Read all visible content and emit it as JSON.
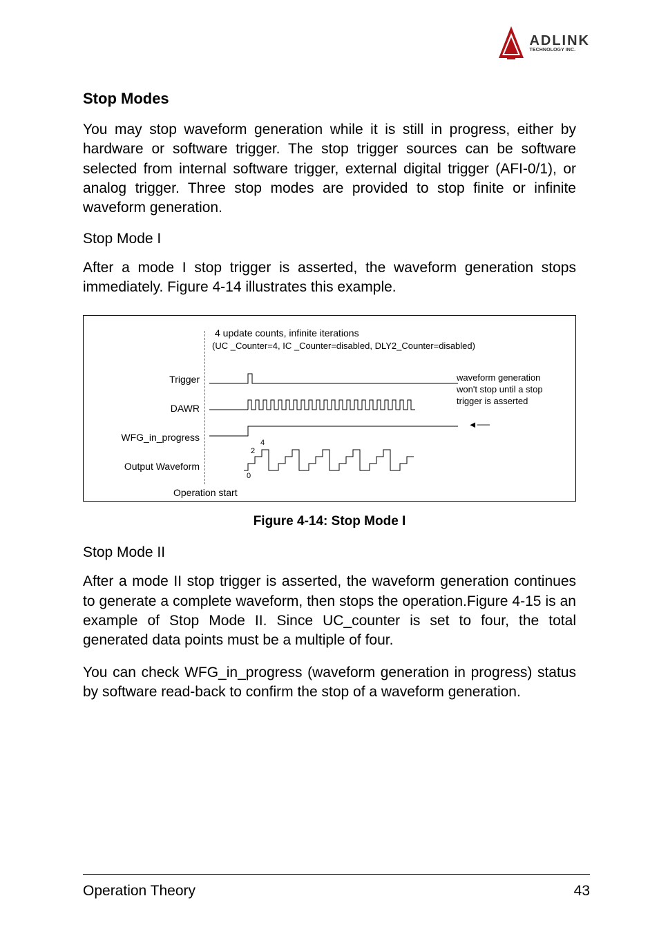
{
  "logo": {
    "brand": "ADLINK",
    "tagline": "TECHNOLOGY INC."
  },
  "section": {
    "heading": "Stop Modes",
    "intro": "You may stop waveform generation while it is still in progress, either by hardware or software trigger. The stop trigger sources can be software selected from internal software trigger, external digital trigger (AFI-0/1), or analog trigger. Three stop modes are provided to stop finite or infinite waveform generation.",
    "mode1_title": "Stop Mode I",
    "mode1_body": "After a mode I stop trigger is asserted, the waveform generation stops immediately. Figure 4-14 illustrates this example.",
    "mode2_title": "Stop Mode II",
    "mode2_body1": "After a mode II stop trigger is asserted, the waveform generation continues to generate a complete waveform, then stops the operation.Figure 4-15 is an example of Stop Mode II. Since UC_counter is set to four, the total generated data points must be a multiple of four.",
    "mode2_body2": "You can check WFG_in_progress (waveform generation in progress) status by software read-back to confirm the stop of a waveform generation."
  },
  "figure": {
    "header": "4 update counts, infinite iterations",
    "subheader": "(UC _Counter=4, IC _Counter=disabled, DLY2_Counter=disabled)",
    "labels": {
      "trigger": "Trigger",
      "dawr": "DAWR",
      "wfg": "WFG_in_progress",
      "output": "Output Waveform"
    },
    "op_start": "Operation start",
    "note": "waveform generation won't stop until a stop trigger is asserted",
    "waveform_levels": {
      "low": "0",
      "mid": "2",
      "high": "4"
    },
    "caption": "Figure 4-14: Stop Mode I"
  },
  "footer": {
    "section_name": "Operation Theory",
    "page_number": "43"
  }
}
